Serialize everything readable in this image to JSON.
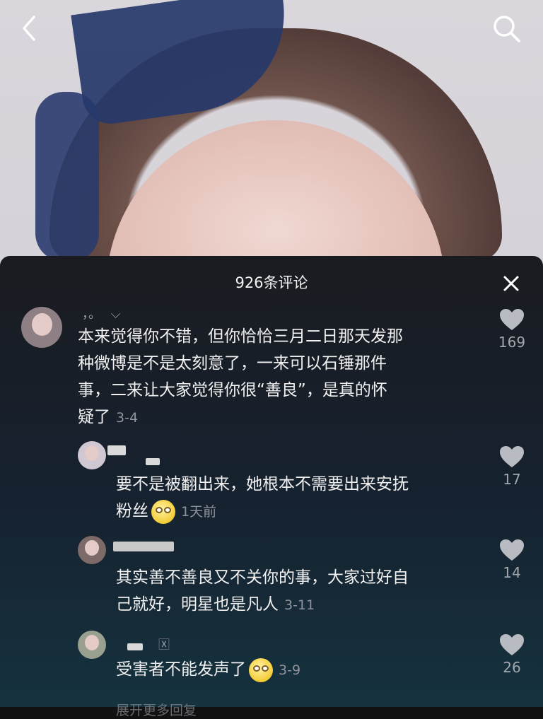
{
  "panel": {
    "title": "926条评论"
  },
  "comments": [
    {
      "name": "，。",
      "text": "本来觉得你不错，但你恰恰三月二日那天发那种微博是不是太刻意了，一来可以石锤那件事，二来让大家觉得你很“善良”，是真的怀疑了",
      "time": "3-4",
      "likes": "169",
      "lines": [
        "本来觉得你不错，但你恰恰三月二日那天发那",
        "种微博是不是太刻意了，一来可以石锤那件",
        "事，二来让大家觉得你很“善良”，是真的怀",
        "疑了"
      ]
    },
    {
      "name": "",
      "text": "要不是被翻出来，她根本不需要出来安抚粉丝",
      "time": "1天前",
      "likes": "17",
      "lines": [
        "要不是被翻出来，她根本不需要出来安抚",
        "粉丝"
      ]
    },
    {
      "name": "",
      "text": "其实善不善良又不关你的事，大家过好自己就好，明星也是凡人",
      "time": "3-11",
      "likes": "14",
      "lines": [
        "其实善不善良又不关你的事，大家过好自",
        "己就好，明星也是凡人"
      ]
    },
    {
      "name": "",
      "text": "受害者不能发声了",
      "time": "3-9",
      "likes": "26",
      "lines": [
        "受害者不能发声了"
      ]
    }
  ],
  "more_replies": "展开更多回复"
}
